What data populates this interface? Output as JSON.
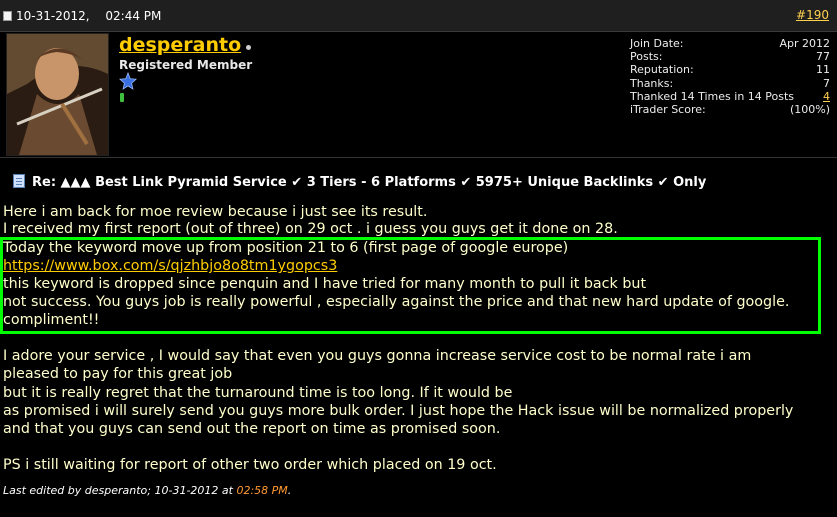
{
  "post": {
    "date": "10-31-2012,",
    "time": "02:44 PM",
    "number": "#190"
  },
  "user": {
    "name": "desperanto",
    "title": "Registered Member",
    "stats": [
      {
        "label": "Join Date:",
        "value": "Apr 2012"
      },
      {
        "label": "Posts:",
        "value": "77"
      },
      {
        "label": "Reputation:",
        "value": "11"
      },
      {
        "label": "Thanks:",
        "value": "7"
      },
      {
        "label": "Thanked 14 Times in 14 Posts",
        "value": "4"
      },
      {
        "label": "iTrader Score:",
        "value": "(100%)"
      }
    ]
  },
  "title": "Re: ▲▲▲ Best Link Pyramid Service ✔ 3 Tiers - 6 Platforms ✔ 5975+ Unique Backlinks ✔ Only",
  "message": {
    "lines": [
      "Here i am back for moe review because i just see its result.",
      "I received my first report (out of three) on 29 oct . i guess you guys get it done on 28.",
      "Today the keyword move up from position 21 to 6 (first page of google europe)",
      "https://www.box.com/s/qjzhbjo8o8tm1ygopcs3",
      "this keyword is dropped since penquin and I have tried for many month to pull it back but",
      "not success. You guys job is really powerful , especially against the price and that new hard update of google.",
      "compliment!!",
      "I adore your service , I would say that even you guys gonna increase service cost to be normal rate i am",
      "pleased to pay for this great job",
      "but it is really regret that the turnaround time is too long. If it would be",
      "as promised i will surely send you guys more bulk order. I just hope the Hack issue will be normalized properly",
      "and that you guys can send out the report on time as promised soon.",
      "PS i still waiting for report of other two order which placed on 19 oct."
    ]
  },
  "edited": {
    "prefix": "Last edited by desperanto; 10-31-2012 at",
    "time": "02:58 PM",
    "suffix": "."
  }
}
